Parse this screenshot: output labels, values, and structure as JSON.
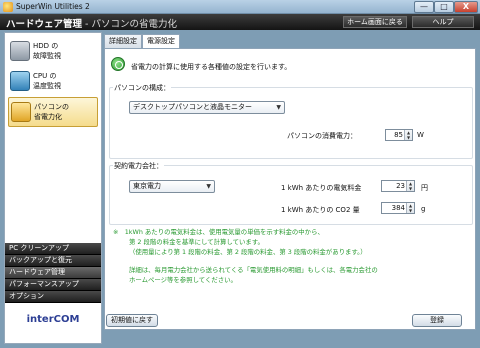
{
  "window": {
    "title": "SuperWin Utilities 2",
    "controls": {
      "minimize": "—",
      "maximize": "□",
      "close": "X"
    }
  },
  "header": {
    "title": "ハードウェア管理",
    "subtitle": " - パソコンの省電力化",
    "home_button": "ホーム画面に戻る",
    "help_button": "ヘルプ"
  },
  "sidebar": {
    "items": [
      {
        "label": "HDD の\n故障監視",
        "icon": "hdd-icon"
      },
      {
        "label": "CPU の\n温度監視",
        "icon": "cpu-icon"
      },
      {
        "label": "パソコンの\n省電力化",
        "icon": "pc-icon",
        "selected": true
      }
    ],
    "menu": [
      "PC クリーンアップ",
      "バックアップと復元",
      "ハードウェア管理",
      "パフォーマンスアップ",
      "オプション"
    ],
    "active_menu": "ハードウェア管理",
    "logo": "interCOM"
  },
  "tabs": [
    "詳細設定",
    "電源設定"
  ],
  "active_tab": "電源設定",
  "intro": "省電力の計算に使用する各種値の設定を行います。",
  "pc_config": {
    "group_label": "パソコンの構成：",
    "selected": "デスクトップパソコンと液晶モニター",
    "power_label": "パソコンの消費電力：",
    "power_value": "85",
    "power_unit": "W"
  },
  "power_company": {
    "group_label": "契約電力会社：",
    "selected": "東京電力",
    "rate_label": "1 kWh あたりの電気料金",
    "rate_value": "23",
    "rate_unit": "円",
    "co2_label": "1 kWh あたりの CO2 量",
    "co2_value": "384",
    "co2_unit": "g"
  },
  "notes": {
    "line1": "※　1kWh あたりの電気料金は、使用電気量の単価を示す料金の中から、",
    "line2": "第 2 段階の料金を基準にして計算しています。",
    "line3": "（使用量により第 1 段階の料金、第 2 段階の料金、第 3 段階の料金があります。）",
    "line4": "詳細は、毎月電力会社から送られてくる「電気使用料の明細」もしくは、各電力会社の",
    "line5": "ホームページ等を参照してください。"
  },
  "buttons": {
    "reset": "初期値に戻す",
    "register": "登録"
  },
  "colors": {
    "note_green": "#2a9a32",
    "header_bg": "#1f1f1f"
  }
}
